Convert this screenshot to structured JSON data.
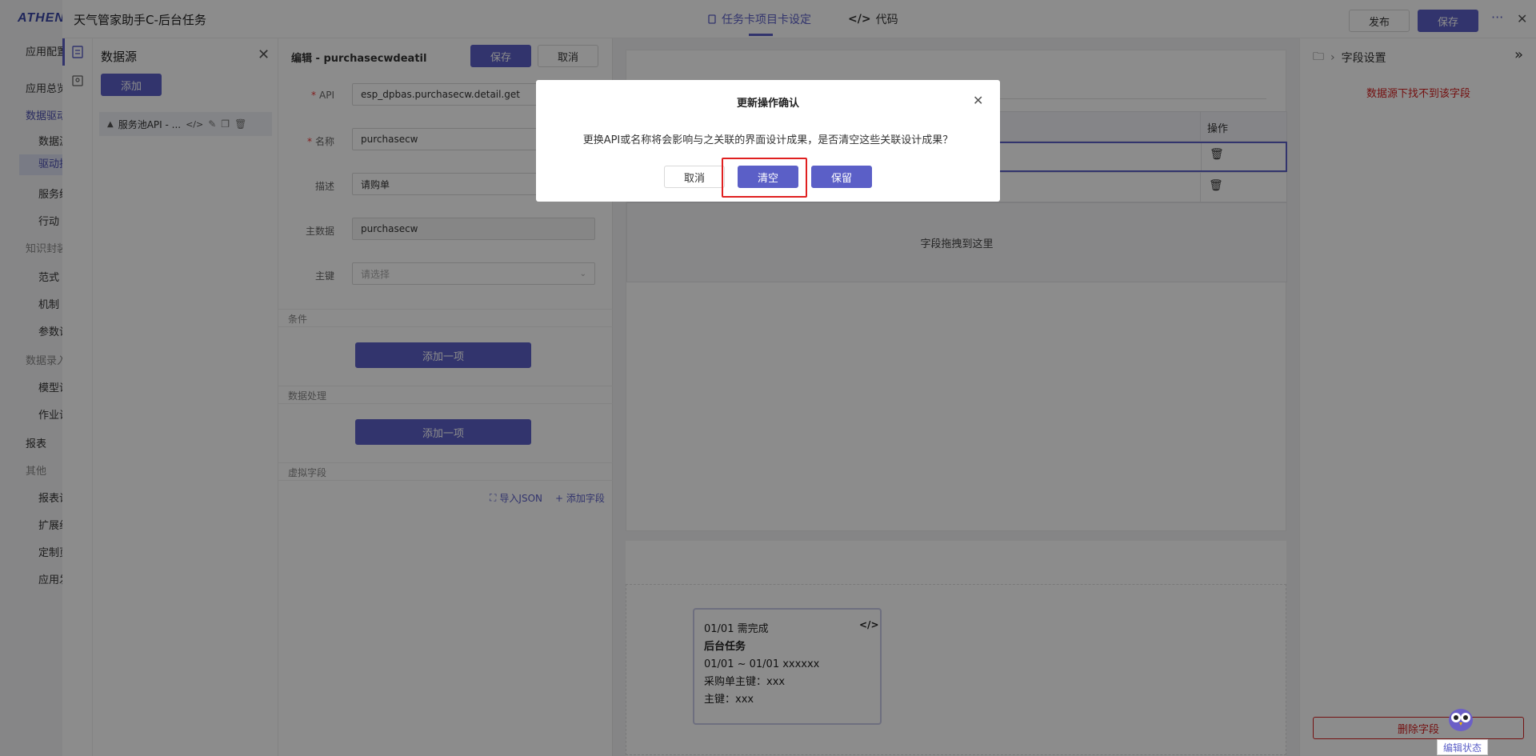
{
  "app_nav": {
    "logo": "ATHENA",
    "items": [
      {
        "label": "应用配置",
        "type": "top"
      },
      {
        "label": "应用总览",
        "type": "top"
      },
      {
        "label": "数据驱动",
        "type": "blue"
      },
      {
        "label": "数据源",
        "type": "sub"
      },
      {
        "label": "驱动执行",
        "type": "sub-active"
      },
      {
        "label": "服务编排",
        "type": "sub"
      },
      {
        "label": "行动",
        "type": "sub"
      },
      {
        "label": "知识封装",
        "type": "sec"
      },
      {
        "label": "范式",
        "type": "sub"
      },
      {
        "label": "机制",
        "type": "sub"
      },
      {
        "label": "参数设定",
        "type": "sub"
      },
      {
        "label": "数据录入",
        "type": "sec"
      },
      {
        "label": "模型设计",
        "type": "sub"
      },
      {
        "label": "作业设计",
        "type": "sub"
      },
      {
        "label": "报表",
        "type": "top"
      },
      {
        "label": "其他",
        "type": "sec"
      },
      {
        "label": "报表设计",
        "type": "sub"
      },
      {
        "label": "扩展组件",
        "type": "sub"
      },
      {
        "label": "定制页面",
        "type": "sub"
      },
      {
        "label": "应用发布",
        "type": "sub"
      }
    ]
  },
  "topbar": {
    "title": "天气管家助手C-后台任务",
    "tab_card": "任务卡项目卡设定",
    "tab_code": "代码",
    "publish": "发布",
    "save": "保存",
    "more": "···",
    "close": "✕"
  },
  "datasource": {
    "title": "数据源",
    "add": "添加",
    "item_label": "服务池API - ..."
  },
  "form": {
    "title": "编辑 - purchasecwdeatil",
    "save": "保存",
    "cancel": "取消",
    "api_label": "API",
    "api_value": "esp_dpbas.purchasecw.detail.get",
    "name_label": "名称",
    "name_value": "purchasecw",
    "desc_label": "描述",
    "desc_value": "请购单",
    "master_label": "主数据",
    "master_value": "purchasecw",
    "key_label": "主键",
    "key_placeholder": "请选择",
    "condition_title": "条件",
    "condition_add": "添加一项",
    "processing_title": "数据处理",
    "processing_add": "添加一项",
    "virtual_title": "虚拟字段",
    "import_json": "导入JSON",
    "add_field": "+ 添加字段"
  },
  "canvas": {
    "op_header": "操作",
    "drop_text": "字段拖拽到这里",
    "card": {
      "line1": "01/01 需完成",
      "line2": "后台任务",
      "line3": "01/01 ~ 01/01 xxxxxx",
      "line4": "采购单主键：xxx",
      "line5": "主键：xxx"
    }
  },
  "right_panel": {
    "title": "字段设置",
    "warning": "数据源下找不到该字段",
    "delete": "删除字段",
    "edit_status": "编辑状态"
  },
  "modal": {
    "title": "更新操作确认",
    "message": "更换API或名称将会影响与之关联的界面设计成果，是否清空这些关联设计成果？",
    "cancel": "取消",
    "clear": "清空",
    "keep": "保留"
  },
  "colors": {
    "primary": "#5b5fc7",
    "danger": "#d42020",
    "highlight": "#e02020"
  }
}
